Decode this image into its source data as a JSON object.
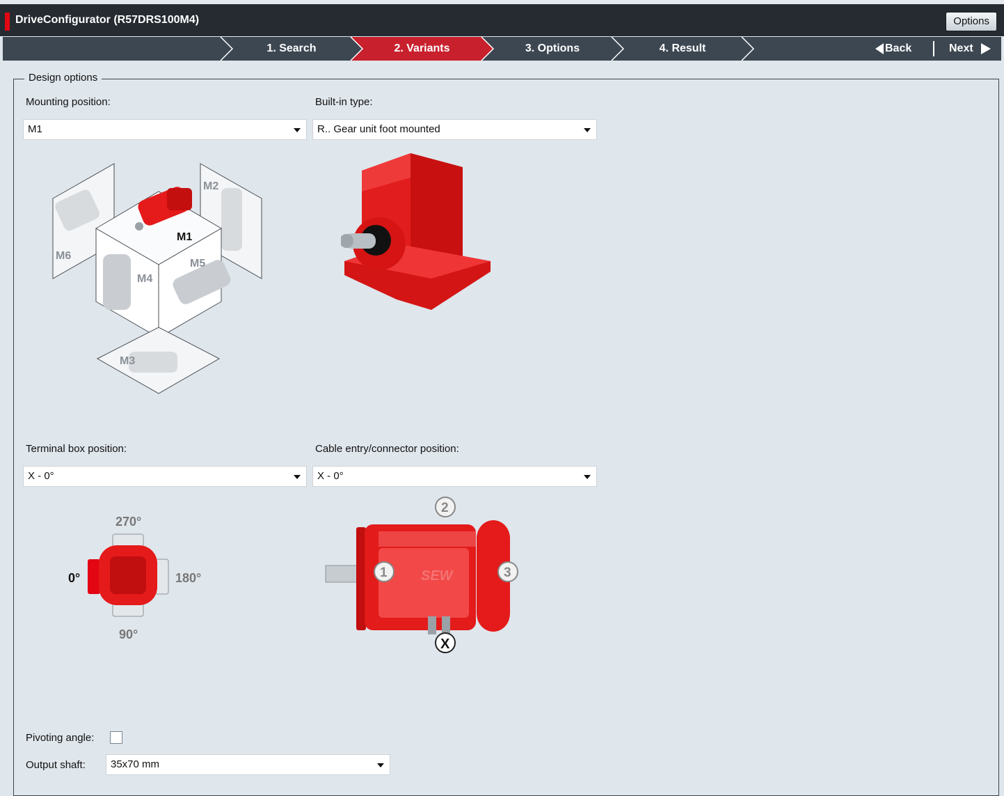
{
  "window": {
    "title": "DriveConfigurator (R57DRS100M4)",
    "options_button": "Options"
  },
  "wizard": {
    "steps": [
      "1. Search",
      "2. Variants",
      "3. Options",
      "4. Result"
    ],
    "active_step": "2. Variants",
    "back_label": "Back",
    "next_label": "Next"
  },
  "design_options": {
    "legend": "Design options",
    "mounting_position": {
      "label": "Mounting position:",
      "value": "M1"
    },
    "built_in_type": {
      "label": "Built-in type:",
      "value": "R.. Gear unit foot mounted"
    },
    "terminal_box_position": {
      "label": "Terminal box position:",
      "value": "X - 0°"
    },
    "cable_entry_position": {
      "label": "Cable entry/connector position:",
      "value": "X - 0°"
    },
    "pivoting_angle": {
      "label": "Pivoting angle:",
      "checked": false
    },
    "output_shaft": {
      "label": "Output shaft:",
      "value": "35x70 mm"
    }
  },
  "mounting_diagram": {
    "positions": [
      "M1",
      "M2",
      "M3",
      "M4",
      "M5",
      "M6"
    ],
    "selected": "M1"
  },
  "terminal_diagram": {
    "angles": [
      "270°",
      "0°",
      "180°",
      "90°"
    ]
  },
  "cable_diagram": {
    "markers": [
      "1",
      "2",
      "3",
      "X"
    ],
    "logo": "SEW"
  },
  "colors": {
    "accent": "#e30613",
    "titlebar": "#252b31",
    "wizard_bar": "#3d4752",
    "active_step": "#c8202d",
    "background": "#dfe6ec"
  }
}
